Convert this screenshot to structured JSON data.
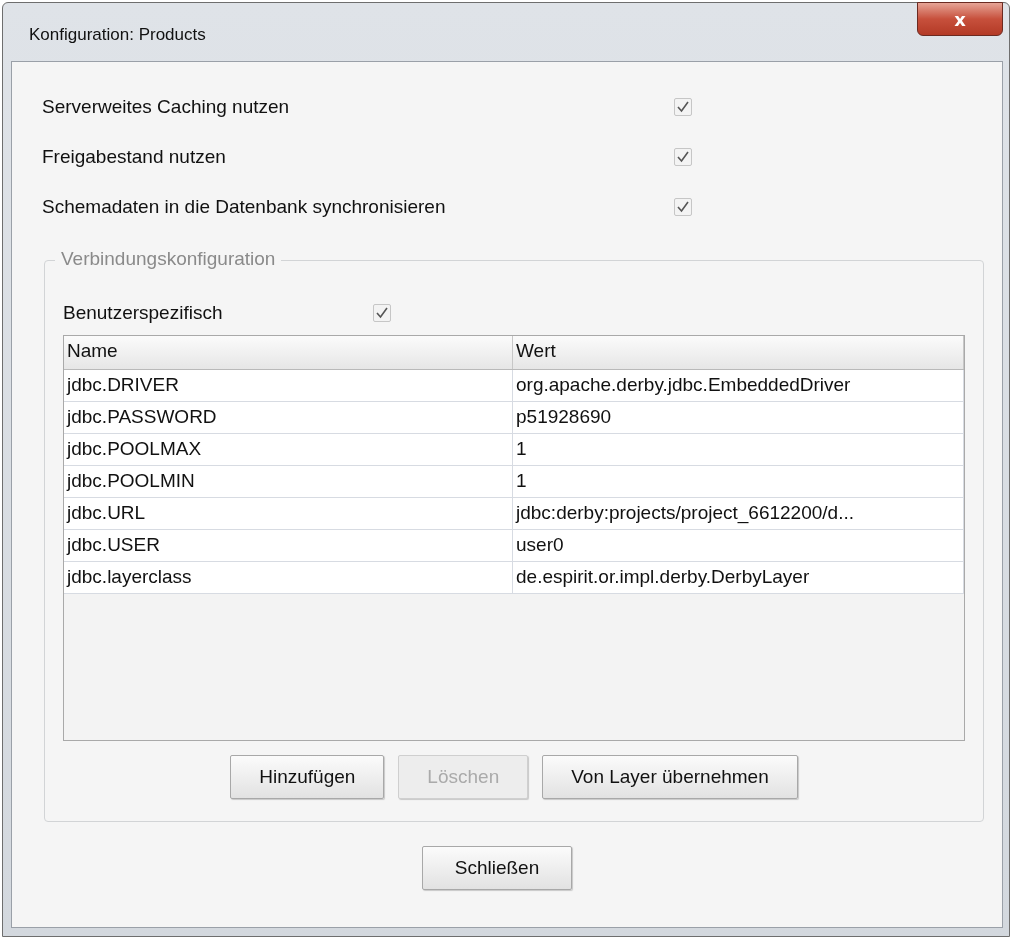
{
  "window": {
    "title": "Konfiguration: Products",
    "close": "x"
  },
  "options": [
    {
      "label": "Serverweites Caching nutzen",
      "checked": true
    },
    {
      "label": "Freigabestand nutzen",
      "checked": true
    },
    {
      "label": "Schemadaten in die Datenbank synchronisieren",
      "checked": true
    }
  ],
  "group": {
    "title": "Verbindungskonfiguration",
    "user_specific": {
      "label": "Benutzerspezifisch",
      "checked": true
    },
    "table": {
      "columns": [
        "Name",
        "Wert"
      ],
      "rows": [
        [
          "jdbc.DRIVER",
          "org.apache.derby.jdbc.EmbeddedDriver"
        ],
        [
          "jdbc.PASSWORD",
          "p51928690"
        ],
        [
          "jdbc.POOLMAX",
          "1"
        ],
        [
          "jdbc.POOLMIN",
          "1"
        ],
        [
          "jdbc.URL",
          "jdbc:derby:projects/project_6612200/d..."
        ],
        [
          "jdbc.USER",
          "user0"
        ],
        [
          "jdbc.layerclass",
          "de.espirit.or.impl.derby.DerbyLayer"
        ]
      ]
    },
    "buttons": [
      {
        "label": "Hinzufügen",
        "disabled": false
      },
      {
        "label": "Löschen",
        "disabled": true
      },
      {
        "label": "Von Layer übernehmen",
        "disabled": false
      }
    ]
  },
  "footer_button": {
    "label": "Schließen",
    "disabled": false
  }
}
